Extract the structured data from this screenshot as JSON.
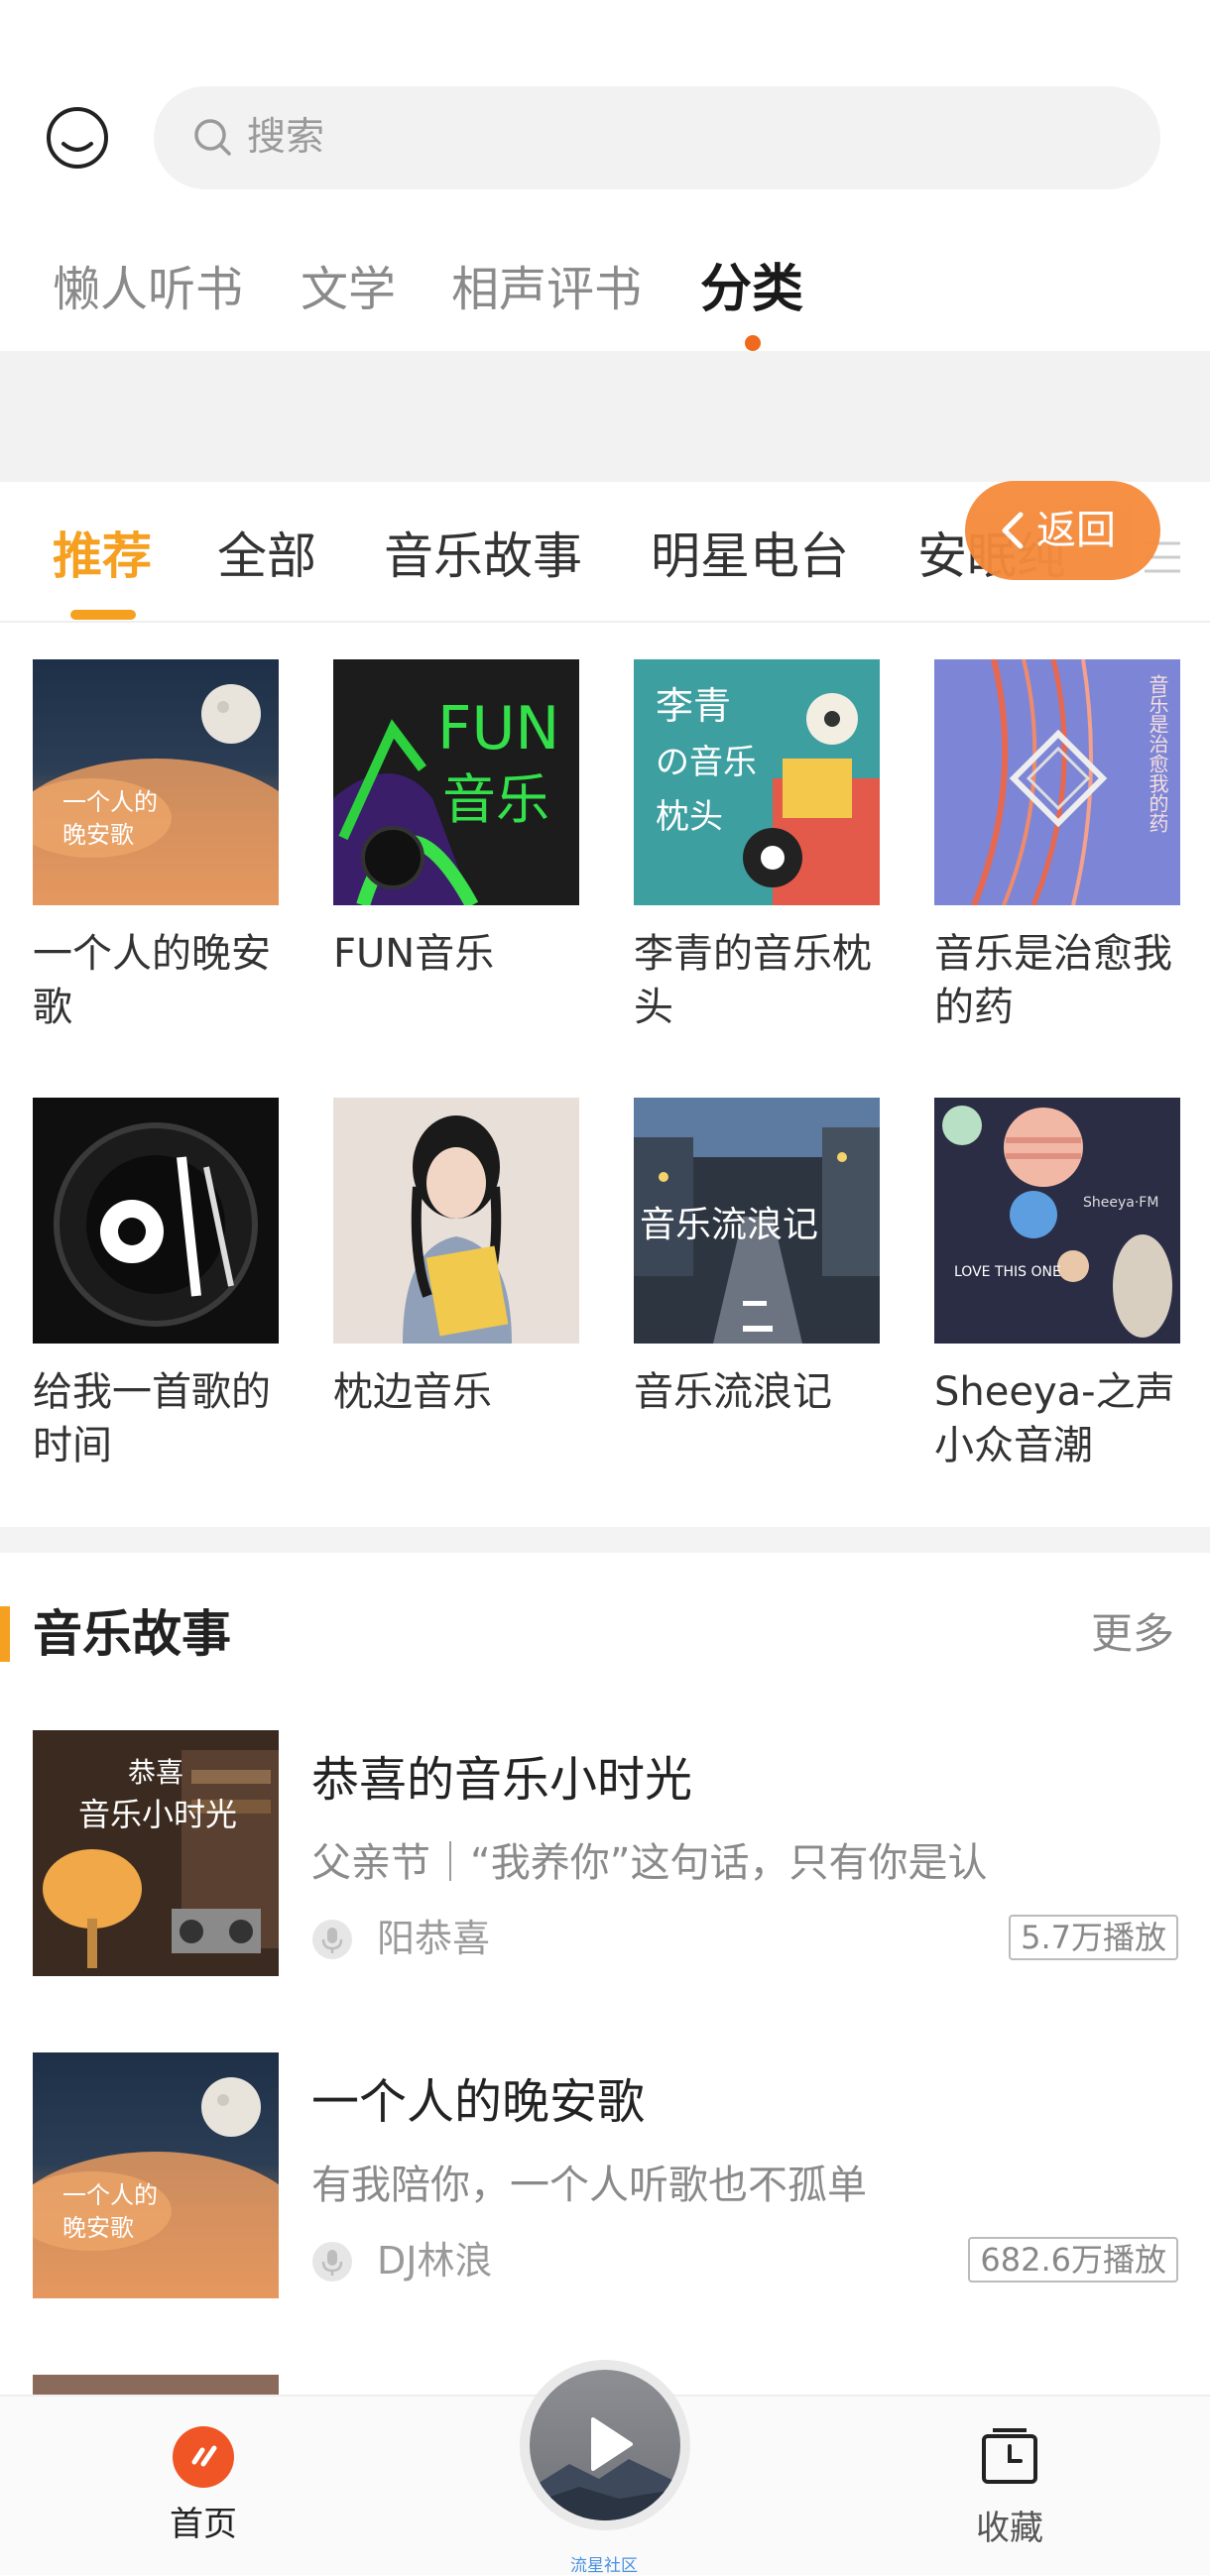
{
  "search": {
    "placeholder": "搜索"
  },
  "top_tabs": [
    {
      "label": "懒人听书"
    },
    {
      "label": "文学"
    },
    {
      "label": "相声评书"
    },
    {
      "label": "分类"
    }
  ],
  "category_tabs": [
    {
      "label": "推荐"
    },
    {
      "label": "全部"
    },
    {
      "label": "音乐故事"
    },
    {
      "label": "明星电台"
    },
    {
      "label": "安眠纯"
    }
  ],
  "back_button": {
    "label": "返回"
  },
  "albums": [
    {
      "title": "一个人的晚安歌",
      "cover_text": [
        "一个人的",
        "晚安歌"
      ]
    },
    {
      "title": "FUN音乐",
      "cover_text": [
        "FUN",
        "音乐"
      ]
    },
    {
      "title": "李青的音乐枕头",
      "cover_text": [
        "李青",
        "の音乐",
        "枕头"
      ]
    },
    {
      "title": "音乐是治愈我的药",
      "cover_text": [
        "音乐是治愈我的药"
      ]
    },
    {
      "title": "给我一首歌的时间",
      "cover_text": []
    },
    {
      "title": "枕边音乐",
      "cover_text": []
    },
    {
      "title": "音乐流浪记",
      "cover_text": [
        "音乐流浪记"
      ]
    },
    {
      "title": "Sheeya-之声小众音潮",
      "cover_text": [
        "Sheeya·FM",
        "LOVE THIS ONE"
      ]
    }
  ],
  "section": {
    "title": "音乐故事",
    "more": "更多"
  },
  "list_items": [
    {
      "title": "恭喜的音乐小时光",
      "desc": "父亲节｜“我养你”这句话，只有你是认",
      "author": "阳恭喜",
      "plays": "5.7万播放",
      "cover_text": [
        "恭喜",
        "音乐小时光"
      ]
    },
    {
      "title": "一个人的晚安歌",
      "desc": "有我陪你，一个人听歌也不孤单",
      "author": "DJ林浪",
      "plays": "682.6万播放",
      "cover_text": [
        "一个人的",
        "晚安歌"
      ]
    }
  ],
  "bottom_nav": {
    "home": "首页",
    "favorites": "收藏",
    "center": "流星社区"
  },
  "colors": {
    "accent": "#f5a020",
    "orange_dot": "#f06a1e",
    "back_button": "#f58a3a"
  }
}
